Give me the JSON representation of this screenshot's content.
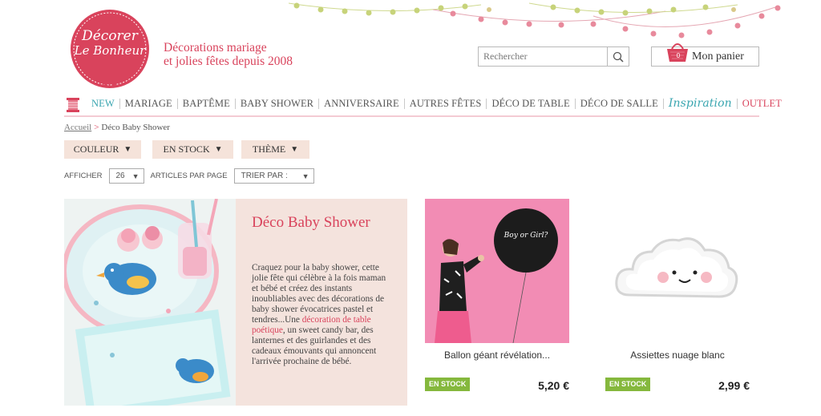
{
  "brand": {
    "logo_line1": "Décorer",
    "logo_line2": "Le Bonheur",
    "tagline_line1": "Décorations mariage",
    "tagline_line2": "et jolies fêtes depuis 2008",
    "accent_color": "#d9435c",
    "teal_color": "#3aa6b0"
  },
  "search": {
    "placeholder": "Rechercher",
    "icon": "magnifier-icon"
  },
  "cart": {
    "label": "Mon panier",
    "count": "0",
    "icon": "basket-icon"
  },
  "nav": {
    "items": [
      {
        "label": "NEW"
      },
      {
        "label": "MARIAGE"
      },
      {
        "label": "BAPTÊME"
      },
      {
        "label": "BABY SHOWER"
      },
      {
        "label": "ANNIVERSAIRE"
      },
      {
        "label": "AUTRES FÊTES"
      },
      {
        "label": "DÉCO DE TABLE"
      },
      {
        "label": "DÉCO DE SALLE"
      },
      {
        "label": "Inspiration"
      },
      {
        "label": "OUTLET"
      }
    ]
  },
  "breadcrumb": {
    "home": "Accueil",
    "separator": ">",
    "current": "Déco Baby Shower"
  },
  "filters": [
    {
      "label": "COULEUR"
    },
    {
      "label": "EN STOCK"
    },
    {
      "label": "THÈME"
    }
  ],
  "listing": {
    "show_label": "AFFICHER",
    "per_page_value": "26",
    "per_page_label": "ARTICLES PAR PAGE",
    "sort_value": "TRIER PAR :"
  },
  "hero": {
    "title": "Déco Baby Shower",
    "text_before_link": "Craquez pour la baby shower, cette jolie fête qui célèbre à la fois maman et bébé et créez des instants inoubliables avec des décorations de baby shower évocatrices pastel et tendres...Une ",
    "link_text": "décoration de table poétique",
    "text_after_link": ", un sweet candy bar, des lanternes et des guirlandes et des cadeaux émouvants qui annoncent l'arrivée prochaine de bébé."
  },
  "products": [
    {
      "name": "Ballon géant révélation...",
      "badge": "EN STOCK",
      "price": "5,20 €",
      "balloon_text": "Boy or Girl?"
    },
    {
      "name": "Assiettes nuage blanc",
      "badge": "EN STOCK",
      "price": "2,99 €"
    }
  ]
}
